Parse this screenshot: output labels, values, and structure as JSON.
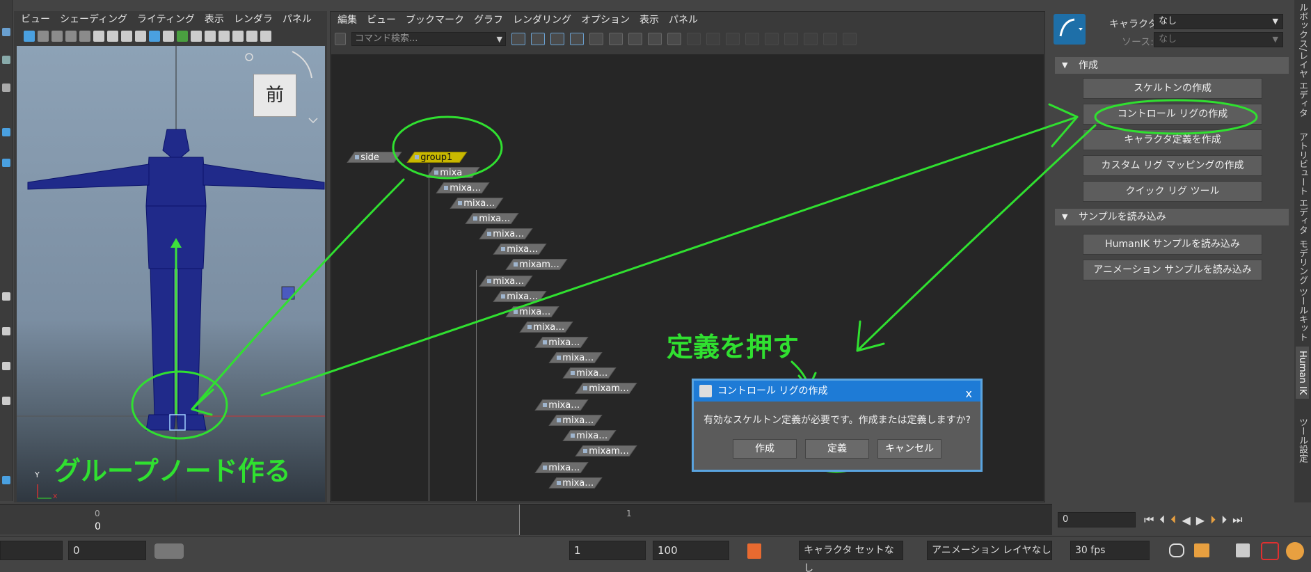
{
  "viewport_menu": [
    "ビュー",
    "シェーディング",
    "ライティング",
    "表示",
    "レンダラ",
    "パネル"
  ],
  "viewport": {
    "view_label": "前",
    "axis_y": "Y",
    "axis_x": "x"
  },
  "graph_menu": [
    "編集",
    "ビュー",
    "ブックマーク",
    "グラフ",
    "レンダリング",
    "オプション",
    "表示",
    "パネル"
  ],
  "command_search_placeholder": "コマンド検索...",
  "nodes": {
    "side": "side",
    "group": "group1",
    "children": [
      "mixa",
      "mixa…",
      "mixa…",
      "mixa…",
      "mixa…",
      "mixa…",
      "mixam…",
      "mixa…",
      "mixa…",
      "mixa…",
      "mixa…",
      "mixa…",
      "mixa…",
      "mixa…",
      "mixam…",
      "mixa…",
      "mixa…",
      "mixa…",
      "mixam…",
      "mixa…",
      "mixa…"
    ]
  },
  "hik": {
    "character_label": "キャラクタ:",
    "character_value": "なし",
    "source_label": "ソース:",
    "source_value": "なし",
    "section_create": "作成",
    "buttons_create": [
      "スケルトンの作成",
      "コントロール リグの作成",
      "キャラクタ定義を作成",
      "カスタム リグ マッピングの作成",
      "クイック リグ ツール"
    ],
    "section_samples": "サンプルを読み込み",
    "buttons_samples": [
      "HumanIK サンプルを読み込み",
      "アニメーション サンプルを読み込み"
    ]
  },
  "side_tabs": [
    "ルボックス/レイヤ エディタ",
    "アトリビュート エディタ",
    "モデリング ツールキット",
    "Human IK",
    "ツール設定"
  ],
  "timeline": {
    "tick_start": "0",
    "tick_one": "1",
    "current_frame": "0",
    "time_field": "0"
  },
  "range": {
    "start_field": "0",
    "play_start": "1",
    "play_end": "100",
    "character_set": "キャラクタ セットなし",
    "anim_layer": "アニメーション レイヤなし",
    "fps": "30 fps"
  },
  "dialog": {
    "title": "コントロール リグの作成",
    "close": "x",
    "message": "有効なスケルトン定義が必要です。作成または定義しますか?",
    "buttons": [
      "作成",
      "定義",
      "キャンセル"
    ]
  },
  "annotations": {
    "press_define": "定義を押す",
    "make_group": "グループノード作る"
  },
  "colors": {
    "annotation": "#30e030",
    "group_node": "#c9b800",
    "dialog_title": "#1e7bd6"
  }
}
